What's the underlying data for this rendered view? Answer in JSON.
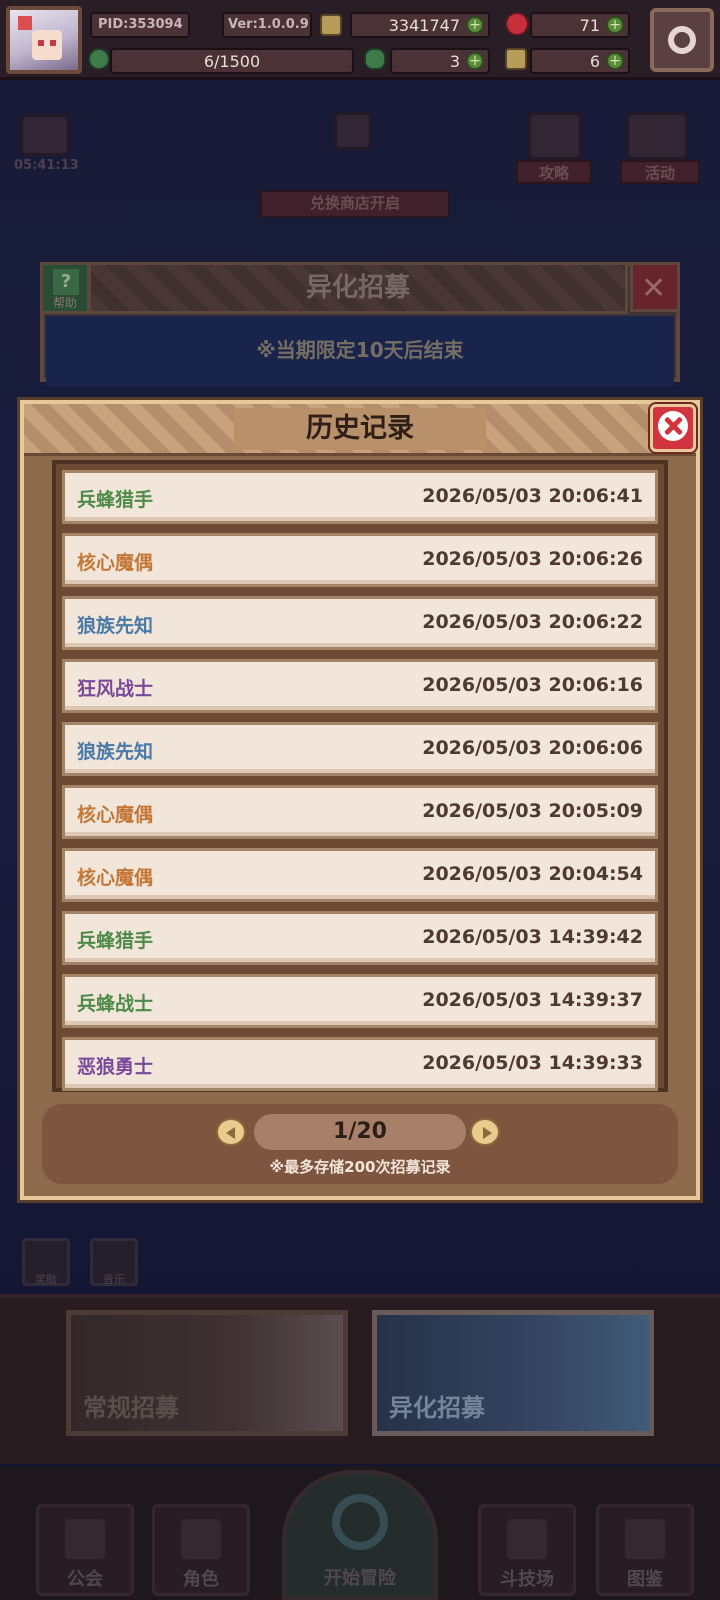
{
  "hud": {
    "pid": "PID:353094",
    "version": "Ver:1.0.0.9",
    "gold": "3341747",
    "gems": "71",
    "stamina": "6/1500",
    "clover": "3",
    "keys": "6",
    "plus": "+"
  },
  "background": {
    "timer": "05:41:13",
    "strategy_label": "攻略",
    "activity_label": "活动",
    "shop_banner": "兑换商店开启",
    "recruit_title": "异化招募",
    "help_label": "帮助",
    "help_symbol": "?",
    "close_symbol": "✕",
    "notice": "※当期限定10天后结束",
    "normal_recruit": "常规招募",
    "alien_recruit": "异化招募",
    "small_btn_1": "奖励",
    "small_btn_2": "音乐"
  },
  "nav": {
    "guild": "公会",
    "character": "角色",
    "adventure": "开始冒险",
    "arena": "斗技场",
    "codex": "图鉴"
  },
  "dialog": {
    "title": "历史记录",
    "records": [
      {
        "name": "兵蜂猎手",
        "time": "2026/05/03 20:06:41",
        "color": "#4e8a4a"
      },
      {
        "name": "核心魔偶",
        "time": "2026/05/03 20:06:26",
        "color": "#c47838"
      },
      {
        "name": "狼族先知",
        "time": "2026/05/03 20:06:22",
        "color": "#4a7aa8"
      },
      {
        "name": "狂风战士",
        "time": "2026/05/03 20:06:16",
        "color": "#7a4a9a"
      },
      {
        "name": "狼族先知",
        "time": "2026/05/03 20:06:06",
        "color": "#4a7aa8"
      },
      {
        "name": "核心魔偶",
        "time": "2026/05/03 20:05:09",
        "color": "#c47838"
      },
      {
        "name": "核心魔偶",
        "time": "2026/05/03 20:04:54",
        "color": "#c47838"
      },
      {
        "name": "兵蜂猎手",
        "time": "2026/05/03 14:39:42",
        "color": "#4e8a4a"
      },
      {
        "name": "兵蜂战士",
        "time": "2026/05/03 14:39:37",
        "color": "#4e8a4a"
      },
      {
        "name": "恶狼勇士",
        "time": "2026/05/03 14:39:33",
        "color": "#7a4a9a"
      }
    ],
    "page": "1/20",
    "note": "※最多存储200次招募记录"
  }
}
